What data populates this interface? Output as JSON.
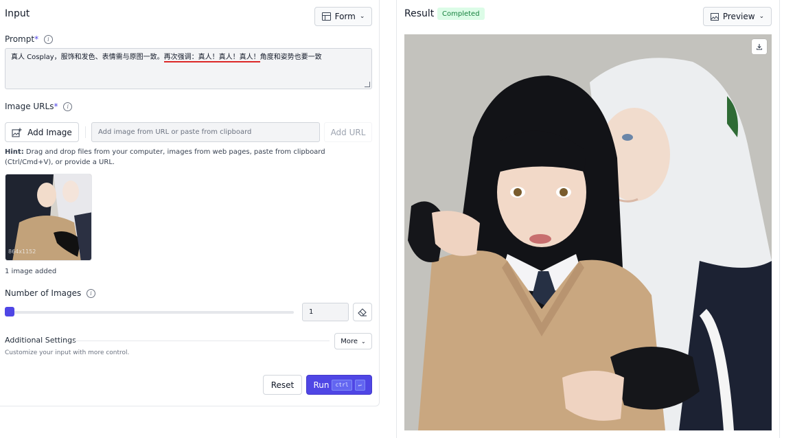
{
  "input": {
    "title": "Input",
    "form_button": "Form",
    "prompt": {
      "label": "Prompt",
      "required_mark": "*",
      "value_before": "真人 Cosplay，服饰和发色、表情需与原图一致。",
      "value_underlined": "再次强调：真人！真人！真人！",
      "value_after": "角度和姿势也要一致"
    },
    "image_urls": {
      "label": "Image URLs",
      "required_mark": "*",
      "add_image_button": "Add Image",
      "url_placeholder": "Add image from URL or paste from clipboard",
      "add_url_button": "Add URL",
      "hint_label": "Hint:",
      "hint_text": " Drag and drop files from your computer, images from web pages, paste from clipboard (Ctrl/Cmd+V), or provide a URL.",
      "thumbnail_caption": "864x1152",
      "images_added": "1 image added"
    },
    "num_images": {
      "label": "Number of Images",
      "value": "1",
      "slider_fraction": 0.0
    },
    "additional": {
      "title": "Additional Settings",
      "subtitle": "Customize your input with more control.",
      "more_button": "More"
    },
    "reset_button": "Reset",
    "run_button": "Run",
    "run_shortcut_ctrl": "ctrl",
    "run_shortcut_enter": "↵"
  },
  "result": {
    "title": "Result",
    "status": "Completed",
    "preview_button": "Preview",
    "download_icon": "download-icon"
  },
  "colors": {
    "accent": "#4f46e5",
    "status_bg": "#dcfce7",
    "status_fg": "#15803d",
    "underline": "#dc2626"
  }
}
